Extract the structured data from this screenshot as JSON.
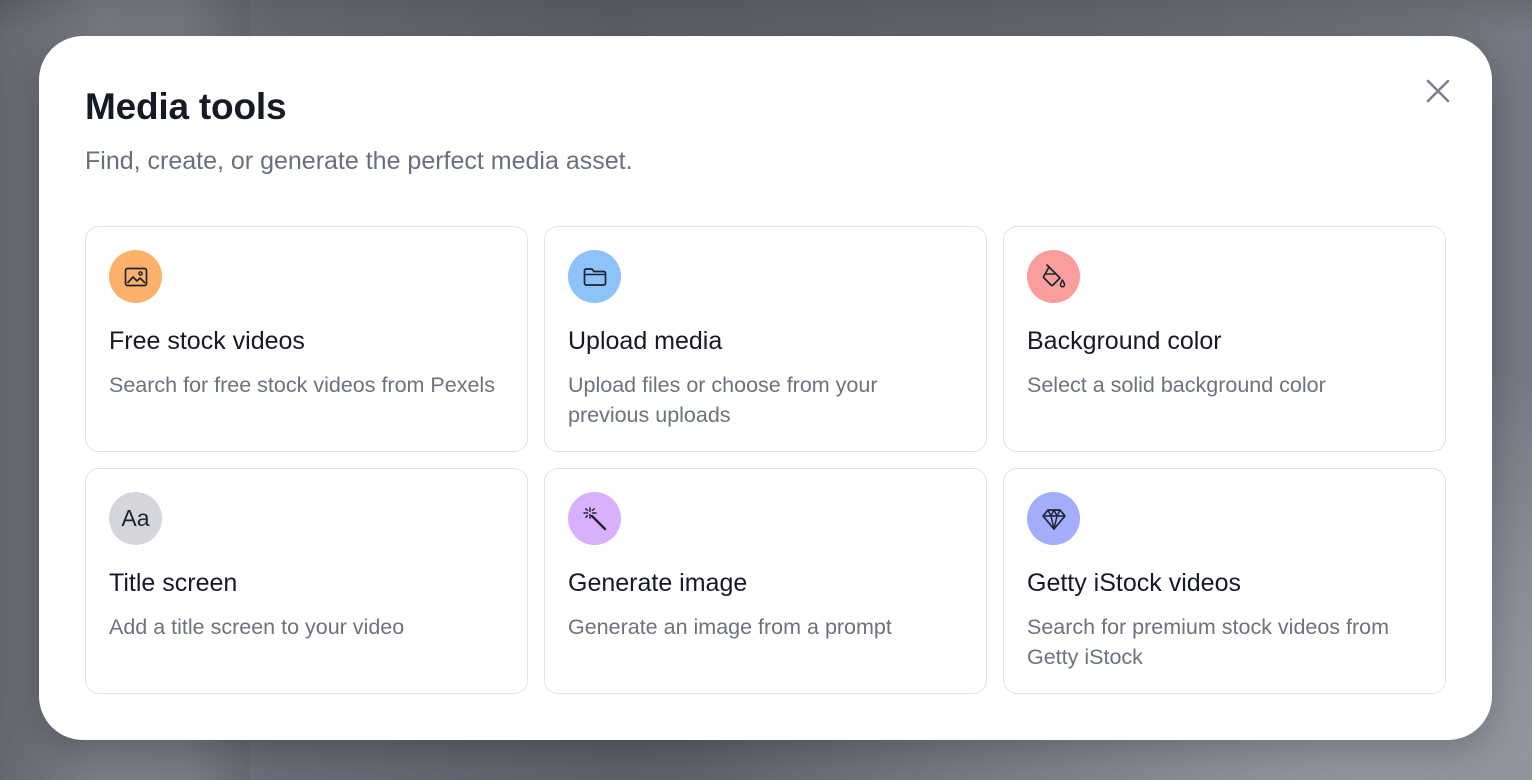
{
  "modal": {
    "title": "Media tools",
    "subtitle": "Find, create, or generate the perfect media asset.",
    "close_icon": "close-icon"
  },
  "tools": [
    {
      "title": "Free stock videos",
      "description": "Search for free stock videos from Pexels",
      "icon": "image-icon",
      "icon_bg": "#fdb06a"
    },
    {
      "title": "Upload media",
      "description": "Upload files or choose from your previous uploads",
      "icon": "folder-icon",
      "icon_bg": "#8ec2fb"
    },
    {
      "title": "Background color",
      "description": "Select a solid background color",
      "icon": "paint-bucket-icon",
      "icon_bg": "#f99d9d"
    },
    {
      "title": "Title screen",
      "description": "Add a title screen to your video",
      "icon": "text-aa-icon",
      "icon_glyph": "Aa",
      "icon_bg": "#d4d6dc"
    },
    {
      "title": "Generate image",
      "description": "Generate an image from a prompt",
      "icon": "magic-wand-icon",
      "icon_bg": "#d8b0fb"
    },
    {
      "title": "Getty iStock videos",
      "description": "Search for premium stock videos from Getty iStock",
      "icon": "diamond-icon",
      "icon_bg": "#a3adfb"
    }
  ],
  "colors": {
    "title_text": "#161a26",
    "secondary_text": "#6b7280",
    "card_border": "#dfe2e8"
  }
}
